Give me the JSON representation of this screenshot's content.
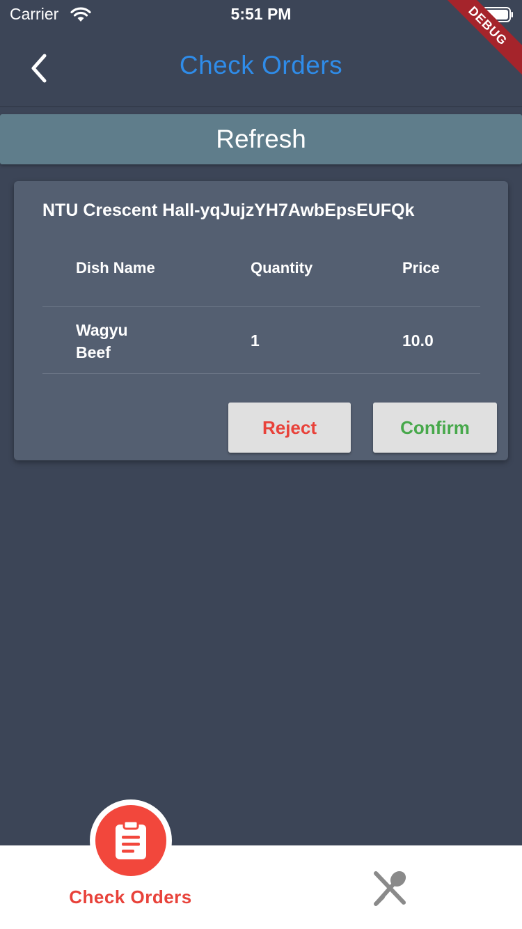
{
  "status_bar": {
    "carrier": "Carrier",
    "time": "5:51 PM"
  },
  "debug_banner": "DEBUG",
  "app_bar": {
    "title": "Check Orders",
    "title_color": "#2f8ce9"
  },
  "refresh": {
    "label": "Refresh",
    "color": "#5f7d8b"
  },
  "order": {
    "title": "NTU Crescent Hall-yqJujzYH7AwbEpsEUFQk",
    "columns": [
      "Dish Name",
      "Quantity",
      "Price"
    ],
    "rows": [
      {
        "dish": "Wagyu Beef",
        "quantity": "1",
        "price": "10.0"
      }
    ],
    "reject_label": "Reject",
    "confirm_label": "Confirm",
    "reject_color": "#e8423a",
    "confirm_color": "#47a84b"
  },
  "bottom_nav": {
    "items": [
      {
        "label": "Check Orders",
        "icon": "clipboard-icon",
        "active": true
      },
      {
        "label": "",
        "icon": "fork-spoon-icon",
        "active": false
      }
    ],
    "active_color": "#f2473c"
  },
  "colors": {
    "background": "#3c4557",
    "card": "#545f71"
  }
}
